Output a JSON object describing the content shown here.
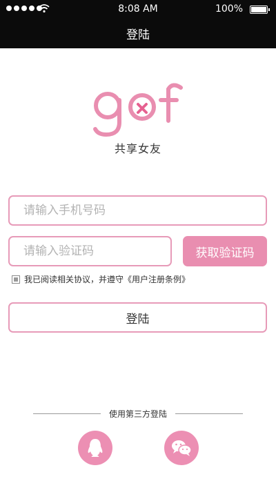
{
  "status_bar": {
    "time": "8:08 AM",
    "battery": "100%",
    "icons": [
      "signal-dots-icon",
      "wifi-icon",
      "battery-icon"
    ]
  },
  "nav": {
    "title": "登陆"
  },
  "logo": {
    "text": "gof",
    "tagline": "共享女友"
  },
  "form": {
    "phone_placeholder": "请输入手机号码",
    "code_placeholder": "请输入验证码",
    "get_code_label": "获取验证码",
    "agreement_text": "我已阅读相关协议，并遵守《用户注册条例》",
    "login_label": "登陆"
  },
  "third_party": {
    "label": "使用第三方登陆",
    "icons": [
      "qq-icon",
      "wechat-icon"
    ]
  },
  "colors": {
    "accent": "#e98eb0",
    "border": "#e79ab8",
    "bar": "#0b0b0b"
  }
}
